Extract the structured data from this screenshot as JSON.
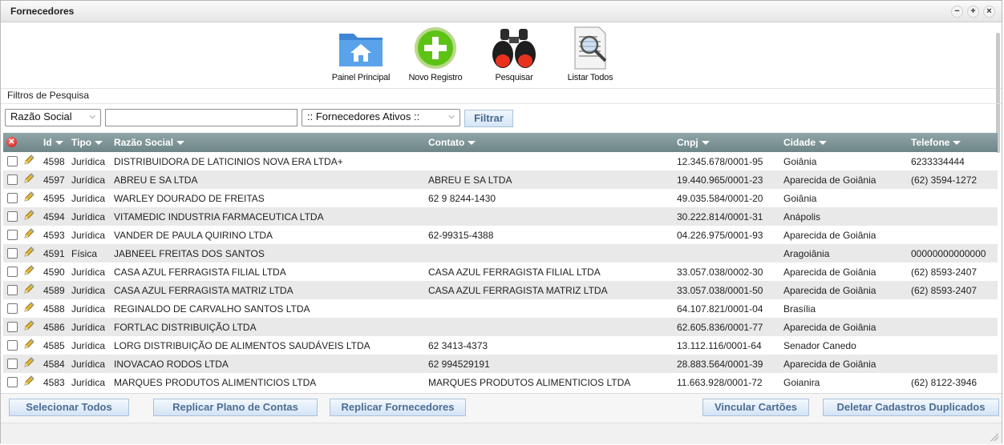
{
  "window": {
    "title": "Fornecedores",
    "controls": [
      "−",
      "+",
      "×"
    ]
  },
  "toolbar": {
    "items": [
      {
        "label": "Painel Principal",
        "icon": "home-folder-icon"
      },
      {
        "label": "Novo Registro",
        "icon": "add-circle-icon"
      },
      {
        "label": "Pesquisar",
        "icon": "binoculars-icon"
      },
      {
        "label": "Listar Todos",
        "icon": "document-search-icon"
      }
    ]
  },
  "filters": {
    "label": "Filtros de Pesquisa",
    "field_select": "Razão Social",
    "text_value": "",
    "status_select": ":: Fornecedores Ativos ::",
    "filter_button": "Filtrar"
  },
  "grid": {
    "columns": [
      "Id",
      "Tipo",
      "Razão Social",
      "Contato",
      "Cnpj",
      "Cidade",
      "Telefone"
    ],
    "rows": [
      {
        "id": "4598",
        "tipo": "Jurídica",
        "razao": "DISTRIBUIDORA DE LATICINIOS NOVA ERA LTDA+",
        "contato": "",
        "cnpj": "12.345.678/0001-95",
        "cidade": "Goiânia",
        "telefone": "6233334444"
      },
      {
        "id": "4597",
        "tipo": "Jurídica",
        "razao": "ABREU E SA LTDA",
        "contato": "ABREU E SA LTDA",
        "cnpj": "19.440.965/0001-23",
        "cidade": "Aparecida de Goiânia",
        "telefone": "(62) 3594-1272"
      },
      {
        "id": "4595",
        "tipo": "Jurídica",
        "razao": "WARLEY DOURADO DE FREITAS",
        "contato": "62 9 8244-1430",
        "cnpj": "49.035.584/0001-20",
        "cidade": "Goiânia",
        "telefone": ""
      },
      {
        "id": "4594",
        "tipo": "Jurídica",
        "razao": "VITAMEDIC INDUSTRIA FARMACEUTICA LTDA",
        "contato": "",
        "cnpj": "30.222.814/0001-31",
        "cidade": "Anápolis",
        "telefone": ""
      },
      {
        "id": "4593",
        "tipo": "Jurídica",
        "razao": "VANDER DE PAULA QUIRINO LTDA",
        "contato": "62-99315-4388",
        "cnpj": "04.226.975/0001-93",
        "cidade": "Aparecida de Goiânia",
        "telefone": ""
      },
      {
        "id": "4591",
        "tipo": "Física",
        "razao": "JABNEEL FREITAS DOS SANTOS",
        "contato": "",
        "cnpj": "",
        "cidade": "Aragoiânia",
        "telefone": "00000000000000"
      },
      {
        "id": "4590",
        "tipo": "Jurídica",
        "razao": "CASA AZUL FERRAGISTA FILIAL LTDA",
        "contato": "CASA AZUL FERRAGISTA FILIAL LTDA",
        "cnpj": "33.057.038/0002-30",
        "cidade": "Aparecida de Goiânia",
        "telefone": "(62) 8593-2407"
      },
      {
        "id": "4589",
        "tipo": "Jurídica",
        "razao": "CASA AZUL FERRAGISTA MATRIZ LTDA",
        "contato": "CASA AZUL FERRAGISTA MATRIZ LTDA",
        "cnpj": "33.057.038/0001-50",
        "cidade": "Aparecida de Goiânia",
        "telefone": "(62) 8593-2407"
      },
      {
        "id": "4588",
        "tipo": "Jurídica",
        "razao": "REGINALDO DE CARVALHO SANTOS LTDA",
        "contato": "",
        "cnpj": "64.107.821/0001-04",
        "cidade": "Brasília",
        "telefone": ""
      },
      {
        "id": "4586",
        "tipo": "Jurídica",
        "razao": "FORTLAC DISTRIBUIÇÃO LTDA",
        "contato": "",
        "cnpj": "62.605.836/0001-77",
        "cidade": "Aparecida de Goiânia",
        "telefone": ""
      },
      {
        "id": "4585",
        "tipo": "Jurídica",
        "razao": "LORG DISTRIBUIÇÃO DE ALIMENTOS SAUDÁVEIS LTDA",
        "contato": "62 3413-4373",
        "cnpj": "13.112.116/0001-64",
        "cidade": "Senador Canedo",
        "telefone": ""
      },
      {
        "id": "4584",
        "tipo": "Jurídica",
        "razao": "INOVACAO RODOS LTDA",
        "contato": "62 994529191",
        "cnpj": "28.883.564/0001-39",
        "cidade": "Aparecida de Goiânia",
        "telefone": ""
      },
      {
        "id": "4583",
        "tipo": "Jurídica",
        "razao": "MARQUES PRODUTOS ALIMENTICIOS LTDA",
        "contato": "MARQUES PRODUTOS ALIMENTICIOS LTDA",
        "cnpj": "11.663.928/0001-72",
        "cidade": "Goianira",
        "telefone": "(62) 8122-3946"
      }
    ]
  },
  "actions": {
    "select_all": "Selecionar Todos",
    "replicate_accounts": "Replicar Plano de Contas",
    "replicate_suppliers": "Replicar Fornecedores",
    "link_cards": "Vincular Cartões",
    "delete_duplicates": "Deletar Cadastros Duplicados"
  },
  "colors": {
    "header_bg": "#7b9294",
    "button_text": "#4e6e93",
    "row_alt": "#e9e9e9"
  }
}
